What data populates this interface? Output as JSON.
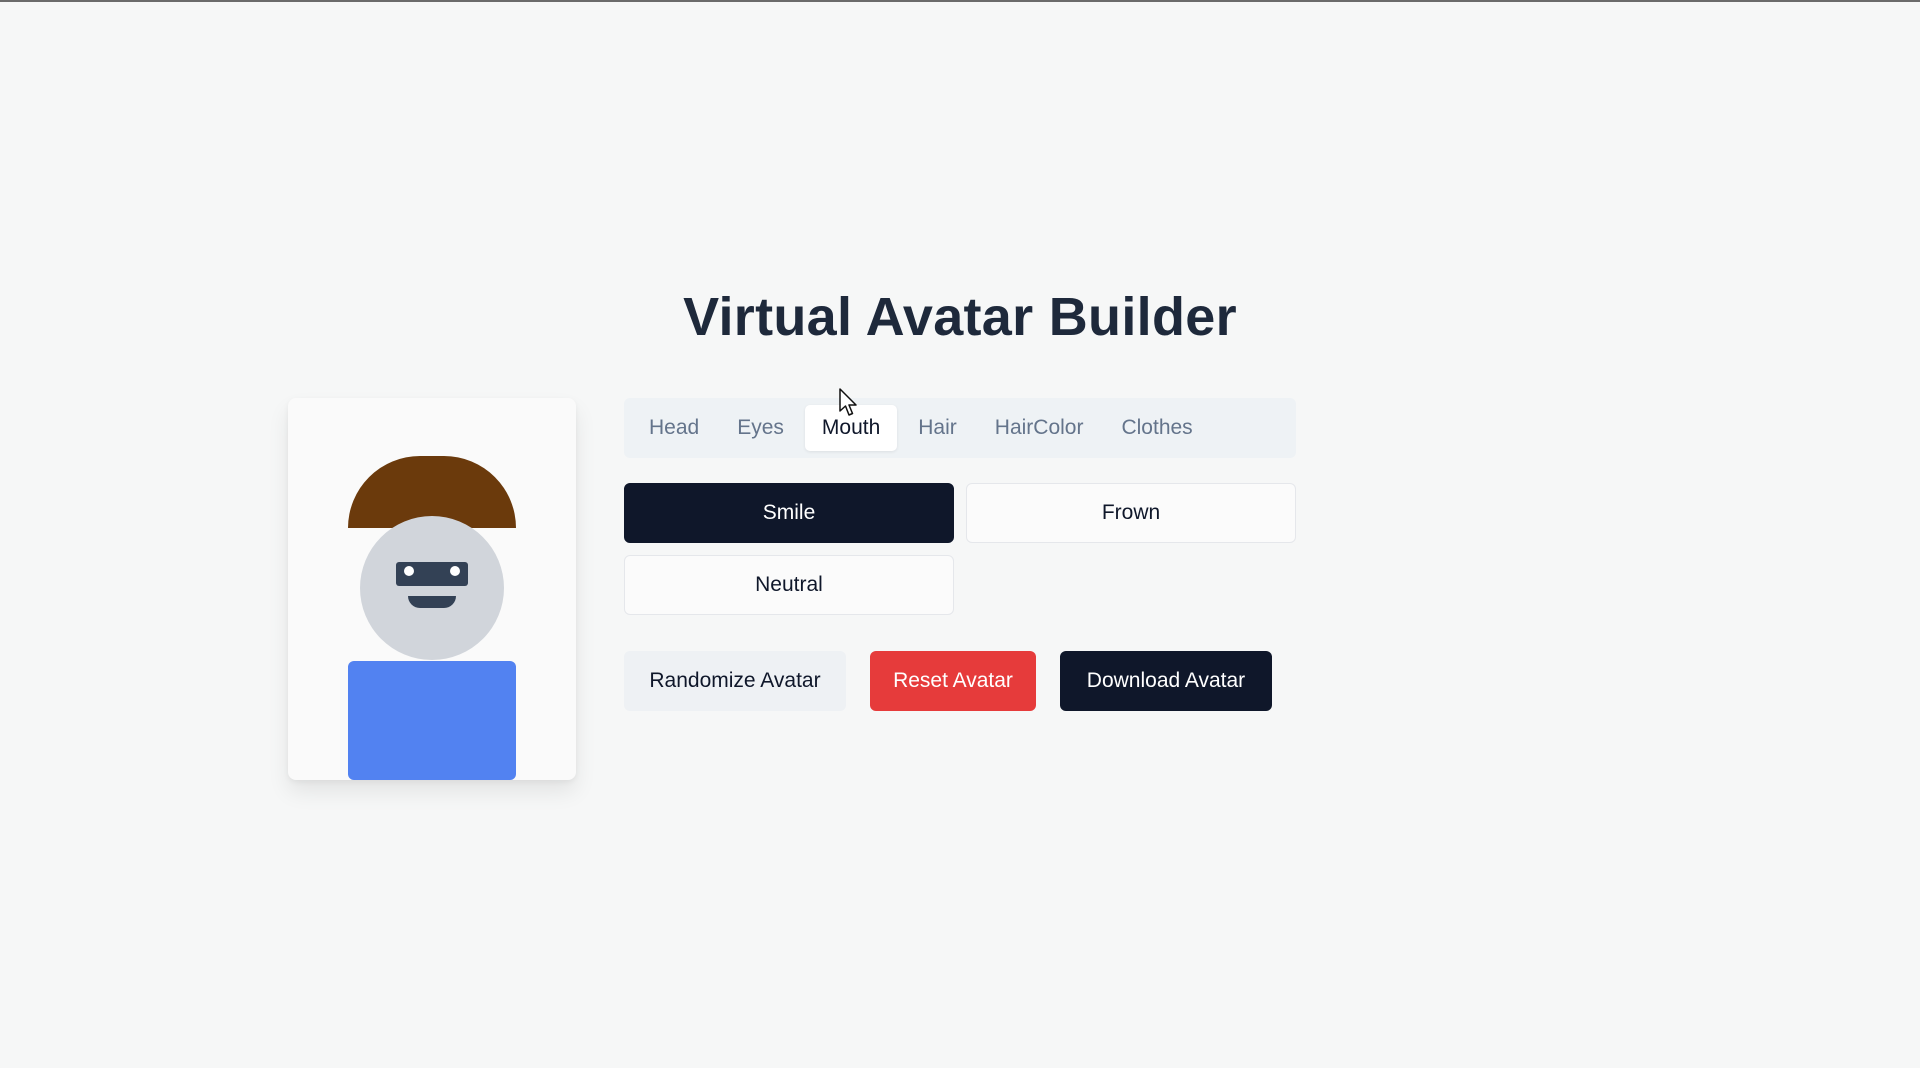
{
  "page": {
    "title": "Virtual Avatar Builder"
  },
  "avatar": {
    "hair_color": "#6b3a0c",
    "head_color": "#d1d5db",
    "feature_color": "#334155",
    "clothes_color": "#5282f1",
    "mouth": "Smile"
  },
  "tabs": [
    {
      "label": "Head",
      "active": false
    },
    {
      "label": "Eyes",
      "active": false
    },
    {
      "label": "Mouth",
      "active": true
    },
    {
      "label": "Hair",
      "active": false
    },
    {
      "label": "HairColor",
      "active": false
    },
    {
      "label": "Clothes",
      "active": false
    }
  ],
  "options": [
    {
      "label": "Smile",
      "selected": true
    },
    {
      "label": "Frown",
      "selected": false
    },
    {
      "label": "Neutral",
      "selected": false
    }
  ],
  "actions": {
    "randomize_label": "Randomize Avatar",
    "reset_label": "Reset Avatar",
    "download_label": "Download Avatar"
  },
  "colors": {
    "background": "#f6f7f7",
    "primary_dark": "#0f172a",
    "danger": "#e63b3b",
    "muted_tab_bg": "#eef2f5"
  }
}
